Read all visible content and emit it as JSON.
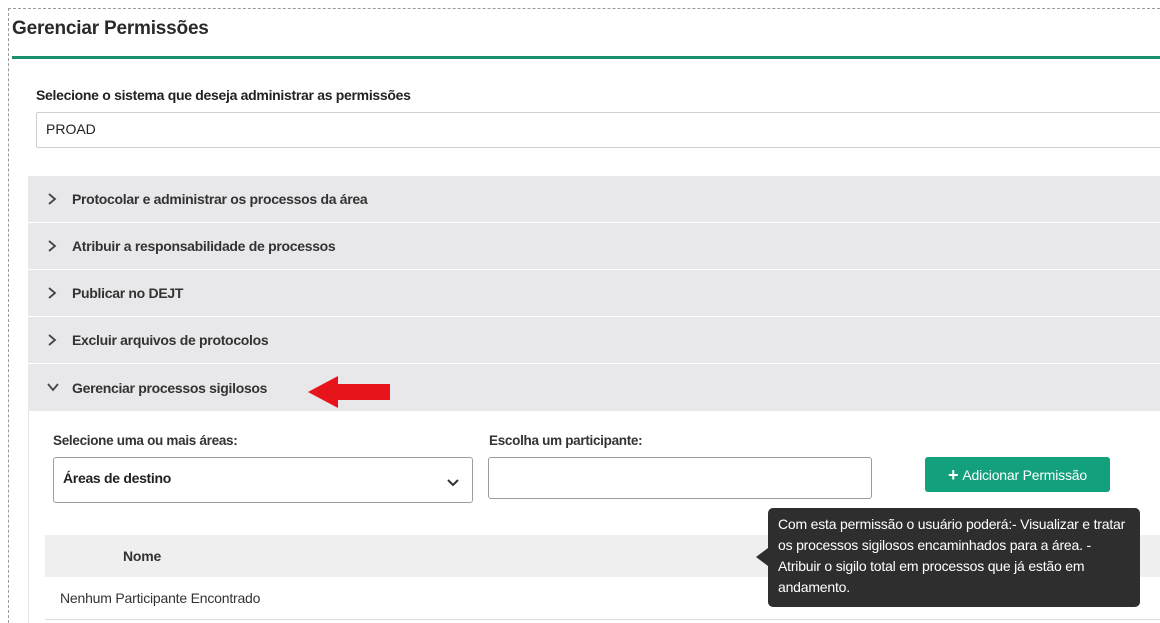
{
  "page": {
    "title": "Gerenciar Permissões"
  },
  "system": {
    "label": "Selecione o sistema que deseja administrar as permissões",
    "selected": "PROAD"
  },
  "accordion": {
    "items": [
      {
        "label": "Protocolar e administrar os processos da área",
        "expanded": false
      },
      {
        "label": "Atribuir a responsabilidade de processos",
        "expanded": false
      },
      {
        "label": "Publicar no DEJT",
        "expanded": false
      },
      {
        "label": "Excluir arquivos de protocolos",
        "expanded": false
      },
      {
        "label": "Gerenciar processos sigilosos",
        "expanded": true
      }
    ]
  },
  "panel": {
    "areas_label": "Selecione uma ou mais áreas:",
    "areas_value": "Áreas de destino",
    "participant_label": "Escolha um participante:",
    "participant_value": "",
    "add_button_label": "Adicionar Permissão",
    "table": {
      "columns": [
        "",
        "Nome"
      ],
      "empty_message": "Nenhum Participante Encontrado"
    }
  },
  "tooltip": {
    "text": "Com esta permissão o usuário poderá:- Visualizar e tratar os processos sigilosos encaminhados para a área. - Atribuir o sigilo total em processos que já estão em andamento."
  },
  "colors": {
    "accent": "#1a8f72",
    "button": "#13a07c",
    "annotation_arrow": "#e8141c",
    "tooltip_bg": "#2e2e2e"
  },
  "icons": {
    "collapsed": "chevron-right-icon",
    "expanded": "chevron-down-icon",
    "dropdown": "chevron-down-icon",
    "add": "plus-icon"
  }
}
